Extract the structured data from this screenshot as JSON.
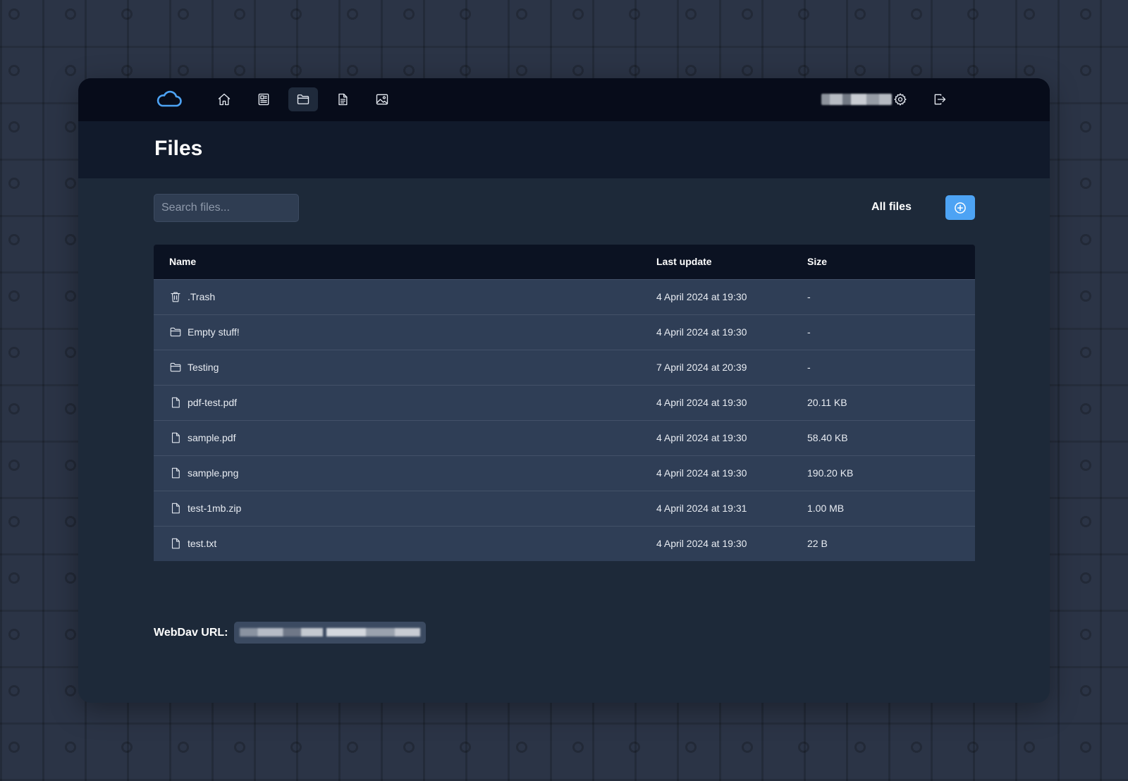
{
  "header": {
    "title": "Files"
  },
  "nav": {
    "items": [
      {
        "name": "home",
        "icon": "home-icon"
      },
      {
        "name": "notes",
        "icon": "newspaper-icon"
      },
      {
        "name": "files",
        "icon": "folder-icon",
        "active": true
      },
      {
        "name": "documents",
        "icon": "document-icon"
      },
      {
        "name": "photos",
        "icon": "image-icon"
      }
    ],
    "right_icons": [
      "settings-gear-icon",
      "logout-icon"
    ]
  },
  "search": {
    "placeholder": "Search files..."
  },
  "toolbar": {
    "filter_label": "All files",
    "add_icon": "plus-circle-icon"
  },
  "table": {
    "columns": [
      "Name",
      "Last update",
      "Size"
    ],
    "rows": [
      {
        "icon": "trash-icon",
        "name": ".Trash",
        "updated": "4 April 2024 at 19:30",
        "size": "-"
      },
      {
        "icon": "folder-icon",
        "name": "Empty stuff!",
        "updated": "4 April 2024 at 19:30",
        "size": "-"
      },
      {
        "icon": "folder-icon",
        "name": "Testing",
        "updated": "7 April 2024 at 20:39",
        "size": "-"
      },
      {
        "icon": "file-icon",
        "name": "pdf-test.pdf",
        "updated": "4 April 2024 at 19:30",
        "size": "20.11 KB"
      },
      {
        "icon": "file-icon",
        "name": "sample.pdf",
        "updated": "4 April 2024 at 19:30",
        "size": "58.40 KB"
      },
      {
        "icon": "file-icon",
        "name": "sample.png",
        "updated": "4 April 2024 at 19:30",
        "size": "190.20 KB"
      },
      {
        "icon": "file-icon",
        "name": "test-1mb.zip",
        "updated": "4 April 2024 at 19:31",
        "size": "1.00 MB"
      },
      {
        "icon": "file-icon",
        "name": "test.txt",
        "updated": "4 April 2024 at 19:30",
        "size": "22 B"
      }
    ]
  },
  "footer": {
    "webdav_label": "WebDav URL:"
  },
  "colors": {
    "accent": "#4da3f4",
    "topbar": "#070c1a",
    "panel": "#1d2939",
    "row": "#2f3e56"
  }
}
